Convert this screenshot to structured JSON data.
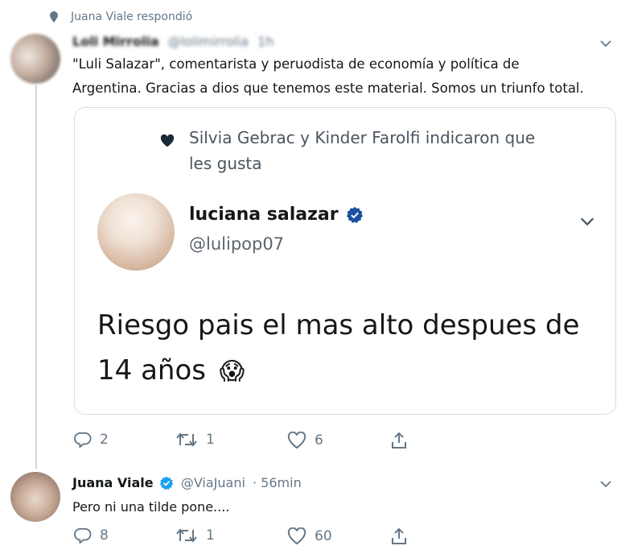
{
  "retweet_header": {
    "text": "Juana Viale respondió"
  },
  "tweet1": {
    "display_name": "Loli Mirrolia",
    "handle": "@lolimirrolia",
    "time": "1h",
    "lines": [
      "\"Luli Salazar\", comentarista y peruodista de economía y política de",
      "Argentina. Gracias a dios que tenemos este material. Somos un triunfo total."
    ],
    "actions": {
      "replies": "2",
      "retweets": "1",
      "likes": "6"
    }
  },
  "quoted": {
    "liked_by_lines": [
      "Silvia Gebrac y Kinder Farolfi indicaron que",
      "les gusta"
    ],
    "display_name": "luciana salazar",
    "handle": "@lulipop07",
    "text_lines": [
      "Riesgo pais el mas alto despues de",
      "14 años"
    ],
    "emoji": "😱"
  },
  "tweet2": {
    "display_name": "Juana Viale",
    "handle": "@ViaJuani",
    "time": "· 56min",
    "text": "Pero ni una tilde pone....",
    "actions": {
      "replies": "8",
      "retweets": "1",
      "likes": "60"
    }
  },
  "colors": {
    "verified": "#1da1f2",
    "muted": "#657786",
    "text": "#14171a",
    "border": "#d6dee4",
    "thread": "#ccd6dd"
  },
  "icons": [
    "heart-small-icon",
    "chevron-down-icon",
    "reply-icon",
    "retweet-icon",
    "like-icon",
    "share-icon",
    "verified-icon"
  ]
}
